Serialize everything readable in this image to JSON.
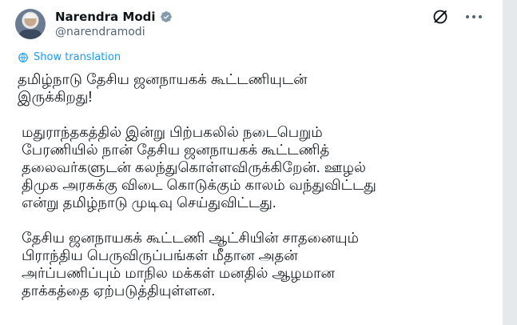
{
  "author": {
    "name": "Narendra Modi",
    "handle": "@narendramodi",
    "verified_icon": "verified-badge-icon",
    "avatar": "profile-photo"
  },
  "actions": {
    "grok_icon": "grok-icon",
    "more_icon": "more-options-icon"
  },
  "translate": {
    "label": "Show translation",
    "icon": "globe-icon"
  },
  "tweet": {
    "paragraphs": [
      "தமிழ்நாடு தேசிய ஜனநாயகக் கூட்டணியுடன்\nஇருக்கிறது!",
      " மதுராந்தகத்தில் இன்று பிற்பகலில் நடைபெறும்\n பேரணியில் நான் தேசிய ஜனநாயகக் கூட்டணித்\n தலைவர்களுடன் கலந்துகொள்ளவிருக்கிறேன். ஊழல்\n திமுக அரசுக்கு விடை கொடுக்கும் காலம் வந்துவிட்டது\n என்று தமிழ்நாடு முடிவு செய்துவிட்டது.",
      " தேசிய ஜனநாயகக் கூட்டணி ஆட்சியின் சாதனையும்\n பிராந்திய பெருவிருப்பங்கள் மீதான அதன்\n அர்ப்பணிப்பும் மாநில மக்கள் மனதில் ஆழமான\n தாக்கத்தை ஏற்படுத்தியுள்ளன."
    ]
  },
  "colors": {
    "link": "#1d9bf0",
    "secondary_text": "#536471",
    "primary_text": "#0f1419"
  }
}
